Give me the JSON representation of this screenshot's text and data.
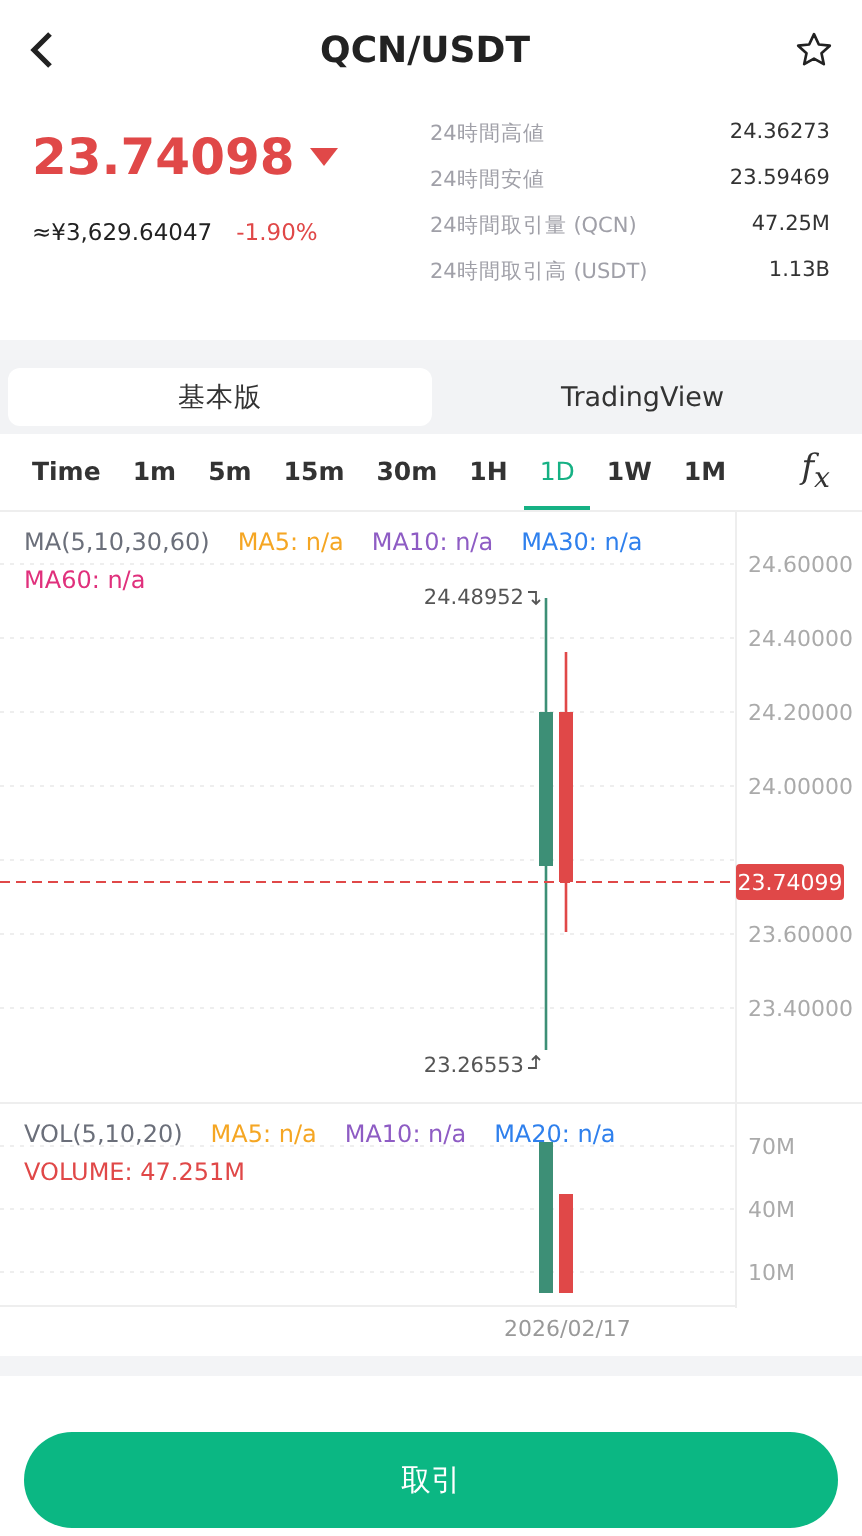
{
  "header": {
    "title": "QCN/USDT",
    "favorite": false
  },
  "ticker": {
    "price": "23.74098",
    "price_down": true,
    "fiat": "≈¥3,629.64047",
    "change": "-1.90%",
    "stats": [
      {
        "label": "24時間高値",
        "value": "24.36273"
      },
      {
        "label": "24時間安値",
        "value": "23.59469"
      },
      {
        "label": "24時間取引量 (QCN)",
        "value": "47.25M"
      },
      {
        "label": "24時間取引高 (USDT)",
        "value": "1.13B"
      }
    ]
  },
  "view_tabs": [
    {
      "label": "基本版",
      "selected": true
    },
    {
      "label": "TradingView",
      "selected": false
    }
  ],
  "intervals": [
    {
      "label": "Time",
      "selected": false
    },
    {
      "label": "1m",
      "selected": false
    },
    {
      "label": "5m",
      "selected": false
    },
    {
      "label": "15m",
      "selected": false
    },
    {
      "label": "30m",
      "selected": false
    },
    {
      "label": "1H",
      "selected": false
    },
    {
      "label": "1D",
      "selected": true
    },
    {
      "label": "1W",
      "selected": false
    },
    {
      "label": "1M",
      "selected": false
    }
  ],
  "indicator_label": "f$_{x}$",
  "main_chart": {
    "legend": [
      {
        "text": "MA(5,10,30,60)",
        "color": "#6b6f7a"
      },
      {
        "text": "MA5: n/a",
        "color": "#f5a623"
      },
      {
        "text": "MA10: n/a",
        "color": "#8e5cc4"
      },
      {
        "text": "MA30: n/a",
        "color": "#2f80ed"
      },
      {
        "text": "MA60: n/a",
        "color": "#e0307c"
      }
    ],
    "high_label": "24.48952",
    "low_label": "23.26553",
    "last_price_tag": "23.74099",
    "axis_labels": [
      "24.60000",
      "24.40000",
      "24.20000",
      "24.00000",
      "23.60000",
      "23.40000"
    ]
  },
  "volume_chart": {
    "legend": [
      {
        "text": "VOL(5,10,20)",
        "color": "#6b6f7a"
      },
      {
        "text": "MA5: n/a",
        "color": "#f5a623"
      },
      {
        "text": "MA10: n/a",
        "color": "#8e5cc4"
      },
      {
        "text": "MA20: n/a",
        "color": "#2f80ed"
      },
      {
        "text": "VOLUME: 47.251M",
        "color": "#e04848"
      }
    ],
    "axis_labels": [
      "70M",
      "40M",
      "10M"
    ],
    "date_label": "2026/02/17"
  },
  "trade_button": "取引"
}
